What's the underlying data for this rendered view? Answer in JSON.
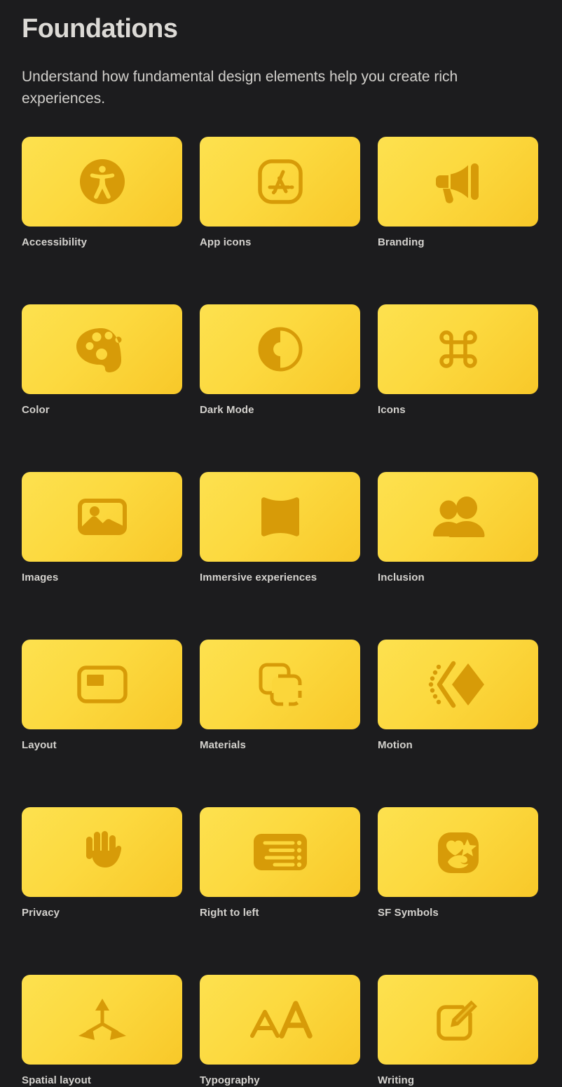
{
  "header": {
    "title": "Foundations",
    "subtitle": "Understand how fundamental design elements help you create rich experiences."
  },
  "theme": {
    "background": "#1c1c1e",
    "tile_gradient_start": "#fde14f",
    "tile_gradient_end": "#f8c829",
    "icon_color": "#d79b08",
    "title_color": "#dcdad6",
    "label_color": "#d4d2ce"
  },
  "grid": {
    "columns": 3,
    "cards": [
      {
        "label": "Accessibility",
        "icon": "accessibility-icon"
      },
      {
        "label": "App icons",
        "icon": "app-store-icon"
      },
      {
        "label": "Branding",
        "icon": "megaphone-icon"
      },
      {
        "label": "Color",
        "icon": "paint-palette-icon"
      },
      {
        "label": "Dark Mode",
        "icon": "contrast-circle-icon"
      },
      {
        "label": "Icons",
        "icon": "command-key-icon"
      },
      {
        "label": "Images",
        "icon": "photo-icon"
      },
      {
        "label": "Immersive experiences",
        "icon": "curved-screen-icon"
      },
      {
        "label": "Inclusion",
        "icon": "two-people-icon"
      },
      {
        "label": "Layout",
        "icon": "layout-frame-icon"
      },
      {
        "label": "Materials",
        "icon": "stacked-squares-icon"
      },
      {
        "label": "Motion",
        "icon": "motion-diamond-icon"
      },
      {
        "label": "Privacy",
        "icon": "raised-hand-icon"
      },
      {
        "label": "Right to left",
        "icon": "rtl-list-icon"
      },
      {
        "label": "SF Symbols",
        "icon": "sf-symbols-icon"
      },
      {
        "label": "Spatial layout",
        "icon": "three-axis-arrows-icon"
      },
      {
        "label": "Typography",
        "icon": "letter-aa-icon"
      },
      {
        "label": "Writing",
        "icon": "pencil-square-icon"
      }
    ]
  }
}
